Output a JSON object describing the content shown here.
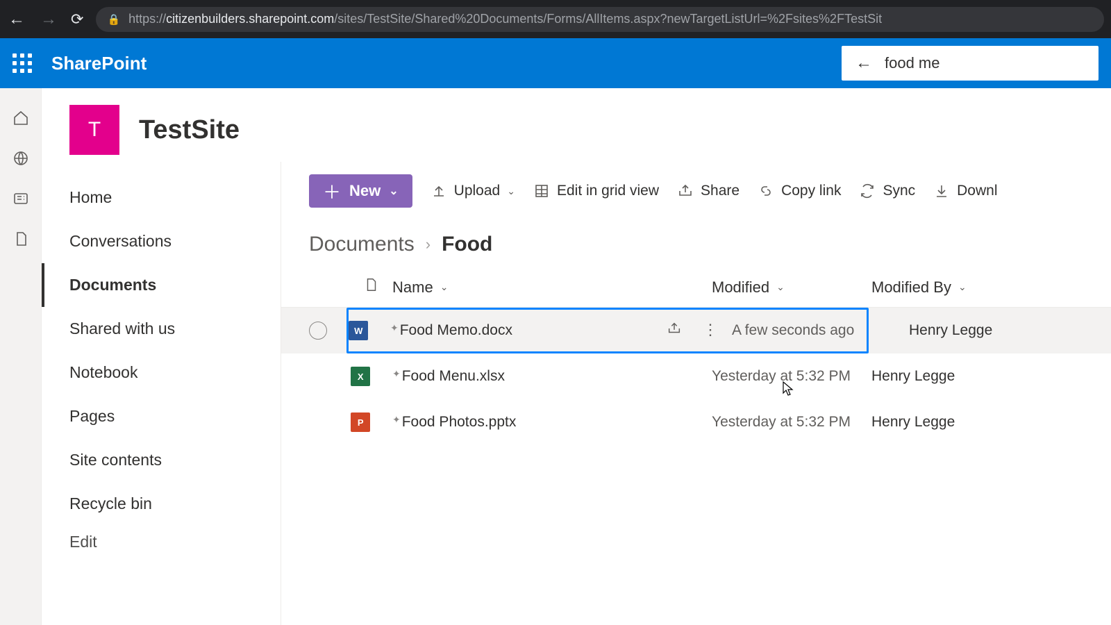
{
  "browser": {
    "url_prefix": "https://",
    "url_host": "citizenbuilders.sharepoint.com",
    "url_path": "/sites/TestSite/Shared%20Documents/Forms/AllItems.aspx?newTargetListUrl=%2Fsites%2FTestSit"
  },
  "brand": "SharePoint",
  "search": {
    "value": "food me"
  },
  "site": {
    "logo_letter": "T",
    "title": "TestSite"
  },
  "nav": {
    "items": [
      "Home",
      "Conversations",
      "Documents",
      "Shared with us",
      "Notebook",
      "Pages",
      "Site contents",
      "Recycle bin",
      "Edit"
    ],
    "active_index": 2
  },
  "cmd": {
    "new": "New",
    "upload": "Upload",
    "edit_grid": "Edit in grid view",
    "share": "Share",
    "copy_link": "Copy link",
    "sync": "Sync",
    "download": "Downl"
  },
  "breadcrumb": {
    "root": "Documents",
    "current": "Food"
  },
  "columns": {
    "name": "Name",
    "modified": "Modified",
    "modified_by": "Modified By"
  },
  "files": [
    {
      "icon": "word",
      "label": "W",
      "name": "Food Memo.docx",
      "modified": "A few seconds ago",
      "by": "Henry Legge",
      "selected": true,
      "new": true
    },
    {
      "icon": "excel",
      "label": "X",
      "name": "Food Menu.xlsx",
      "modified": "Yesterday at 5:32 PM",
      "by": "Henry Legge",
      "selected": false,
      "new": true
    },
    {
      "icon": "ppt",
      "label": "P",
      "name": "Food Photos.pptx",
      "modified": "Yesterday at 5:32 PM",
      "by": "Henry Legge",
      "selected": false,
      "new": true
    }
  ]
}
